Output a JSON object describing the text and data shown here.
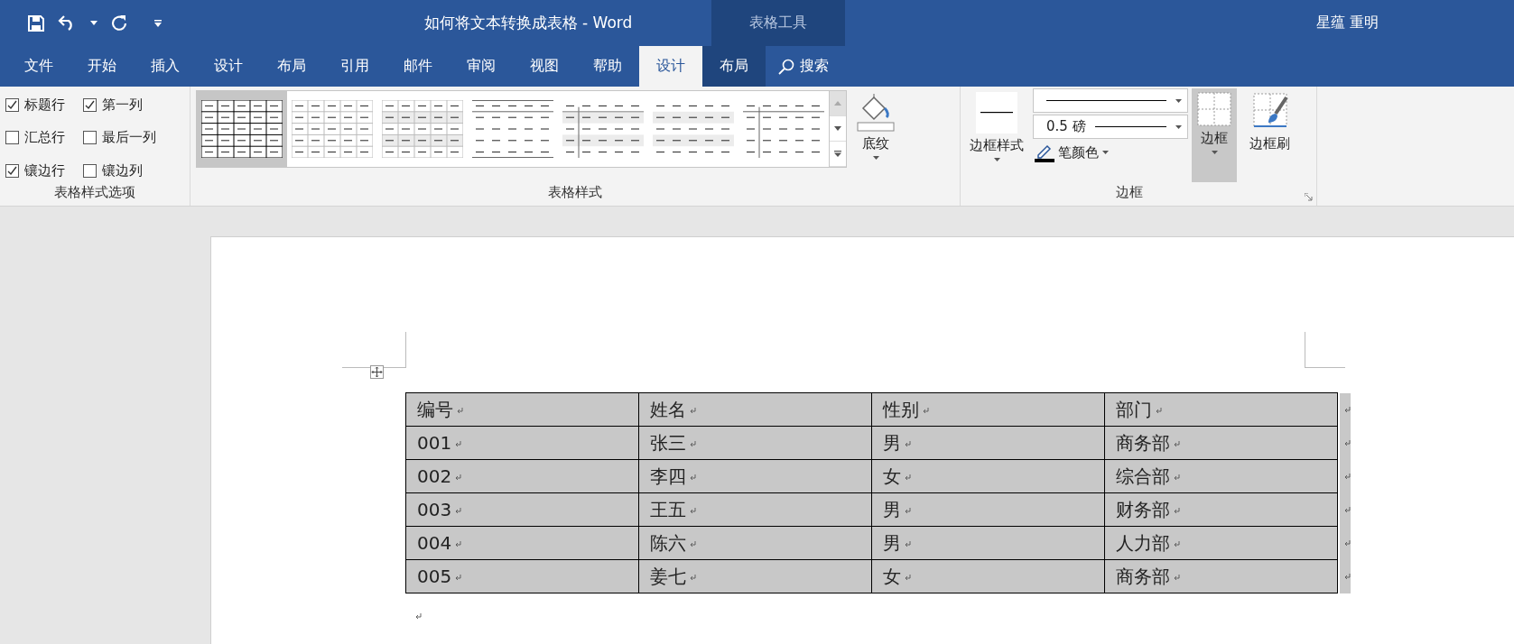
{
  "window": {
    "title": "如何将文本转换成表格  -  Word",
    "context_group": "表格工具",
    "user": "星蕴 重明"
  },
  "tabs": [
    {
      "label": "文件",
      "selected": false,
      "contextual": false
    },
    {
      "label": "开始",
      "selected": false,
      "contextual": false
    },
    {
      "label": "插入",
      "selected": false,
      "contextual": false
    },
    {
      "label": "设计",
      "selected": false,
      "contextual": false
    },
    {
      "label": "布局",
      "selected": false,
      "contextual": false
    },
    {
      "label": "引用",
      "selected": false,
      "contextual": false
    },
    {
      "label": "邮件",
      "selected": false,
      "contextual": false
    },
    {
      "label": "审阅",
      "selected": false,
      "contextual": false
    },
    {
      "label": "视图",
      "selected": false,
      "contextual": false
    },
    {
      "label": "帮助",
      "selected": false,
      "contextual": false
    },
    {
      "label": "设计",
      "selected": true,
      "contextual": true
    },
    {
      "label": "布局",
      "selected": false,
      "contextual": true
    }
  ],
  "search": {
    "label": "搜索"
  },
  "style_options": {
    "group_label": "表格样式选项",
    "items": [
      {
        "label": "标题行",
        "checked": true
      },
      {
        "label": "第一列",
        "checked": true
      },
      {
        "label": "汇总行",
        "checked": false
      },
      {
        "label": "最后一列",
        "checked": false
      },
      {
        "label": "镶边行",
        "checked": true
      },
      {
        "label": "镶边列",
        "checked": false
      }
    ]
  },
  "table_styles": {
    "group_label": "表格样式",
    "gallery": [
      {
        "kind": "grid",
        "selected": true
      },
      {
        "kind": "light-grid",
        "selected": false
      },
      {
        "kind": "banded-grid",
        "selected": false
      },
      {
        "kind": "rules",
        "selected": false
      },
      {
        "kind": "banded-first-column",
        "selected": false
      },
      {
        "kind": "banded",
        "selected": false
      },
      {
        "kind": "rules-first-column",
        "selected": false
      }
    ],
    "shading": "底纹"
  },
  "borders": {
    "group_label": "边框",
    "border_styles": "边框样式",
    "weight": "0.5 磅",
    "pen_color": "笔颜色",
    "borders_button": "边框",
    "borders_pressed": true,
    "border_painter": "边框刷"
  },
  "document_table": {
    "columns": [
      "编号",
      "姓名",
      "性别",
      "部门"
    ],
    "rows": [
      [
        "001",
        "张三",
        "男",
        "商务部"
      ],
      [
        "002",
        "李四",
        "女",
        "综合部"
      ],
      [
        "003",
        "王五",
        "男",
        "财务部"
      ],
      [
        "004",
        "陈六",
        "男",
        "人力部"
      ],
      [
        "005",
        "姜七",
        "女",
        "商务部"
      ]
    ]
  }
}
